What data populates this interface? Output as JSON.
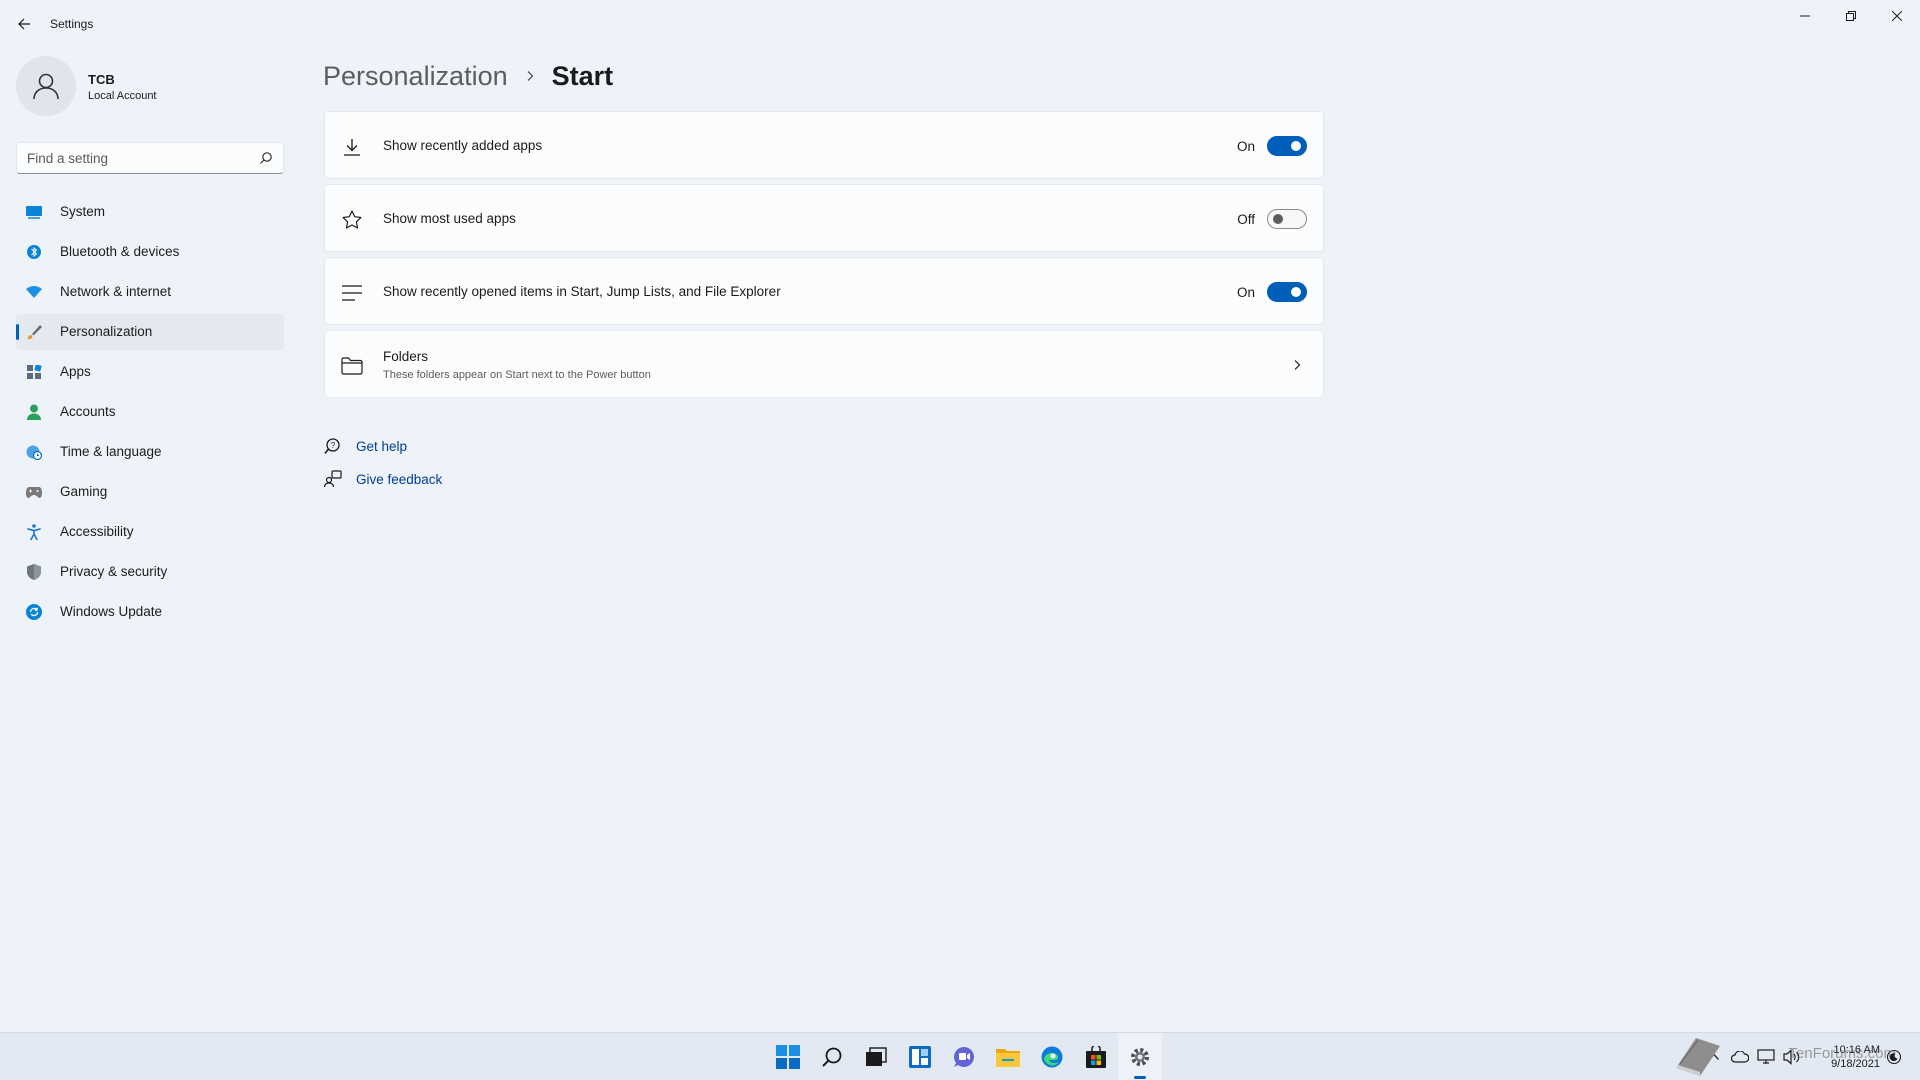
{
  "window": {
    "title": "Settings"
  },
  "profile": {
    "name": "TCB",
    "account_type": "Local Account"
  },
  "search": {
    "placeholder": "Find a setting"
  },
  "sidebar": {
    "items": [
      {
        "label": "System",
        "icon": "system-icon",
        "color": "#0078d4"
      },
      {
        "label": "Bluetooth & devices",
        "icon": "bluetooth-icon",
        "color": "#0078d4"
      },
      {
        "label": "Network & internet",
        "icon": "wifi-icon",
        "color": "#0078d4"
      },
      {
        "label": "Personalization",
        "icon": "brush-icon",
        "color": "#e8912d",
        "selected": true
      },
      {
        "label": "Apps",
        "icon": "apps-icon",
        "color": "#5b6b7f"
      },
      {
        "label": "Accounts",
        "icon": "accounts-icon",
        "color": "#2aa05a"
      },
      {
        "label": "Time & language",
        "icon": "globe-clock-icon",
        "color": "#0078d4"
      },
      {
        "label": "Gaming",
        "icon": "gamepad-icon",
        "color": "#6b6b6b"
      },
      {
        "label": "Accessibility",
        "icon": "accessibility-icon",
        "color": "#1a73c8"
      },
      {
        "label": "Privacy & security",
        "icon": "shield-icon",
        "color": "#6b6b6b"
      },
      {
        "label": "Windows Update",
        "icon": "update-icon",
        "color": "#0078d4"
      }
    ]
  },
  "breadcrumb": {
    "parent": "Personalization",
    "current": "Start"
  },
  "settings": [
    {
      "label": "Show recently added apps",
      "state_label": "On",
      "on": true,
      "icon": "download-icon"
    },
    {
      "label": "Show most used apps",
      "state_label": "Off",
      "on": false,
      "icon": "star-icon"
    },
    {
      "label": "Show recently opened items in Start, Jump Lists, and File Explorer",
      "state_label": "On",
      "on": true,
      "icon": "list-icon"
    }
  ],
  "folders": {
    "label": "Folders",
    "description": "These folders appear on Start next to the Power button",
    "icon": "folder-icon"
  },
  "help": {
    "get_help": "Get help",
    "give_feedback": "Give feedback"
  },
  "taskbar": {
    "apps": [
      "windows-start-icon",
      "search-icon",
      "task-view-icon",
      "widgets-icon",
      "chat-icon",
      "file-explorer-icon",
      "edge-icon",
      "store-icon",
      "settings-gear-icon"
    ],
    "active": "settings-gear-icon",
    "clock_time": "10:16 AM",
    "clock_date": "9/18/2021",
    "watermark": "TenForums.com"
  },
  "colors": {
    "accent": "#005fb8",
    "background": "#eef2f9",
    "card": "#fbfcfe",
    "link": "#003e92"
  }
}
